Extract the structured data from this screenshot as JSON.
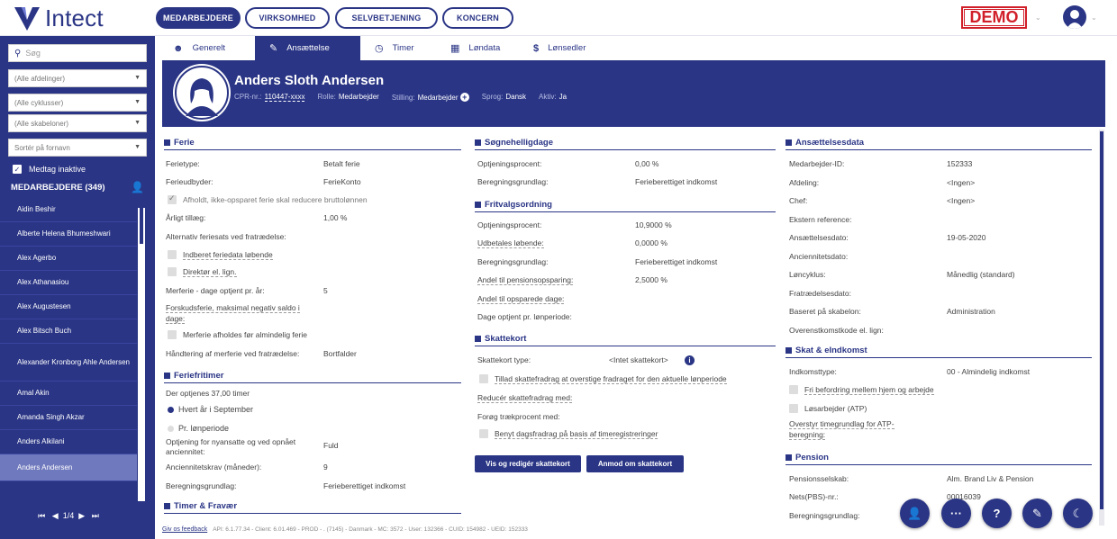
{
  "app": {
    "logo_text": "Intect",
    "demo_label": "DEMO"
  },
  "nav": [
    "MEDARBEJDERE",
    "VIRKSOMHED",
    "SELVBETJENING",
    "KONCERN"
  ],
  "left": {
    "search_placeholder": "Søg",
    "filters": [
      "(Alle afdelinger)",
      "(Alle cyklusser)",
      "(Alle skabeloner)",
      "Sortér på fornavn"
    ],
    "include_inactive": "Medtag inaktive",
    "count_label": "MEDARBEJDERE (349)",
    "employees": [
      "Aidin Beshir",
      "Alberte Helena Bhumeshwari",
      "Alex Agerbo",
      "Alex Athanasiou",
      "Alex Augustesen",
      "Alex Bitsch Buch",
      "Alexander Kronborg Ahle Andersen",
      "Amal Akin",
      "Amanda Singh Akzar",
      "Anders Alkilani",
      "Anders Andersen"
    ],
    "pager": "1/4"
  },
  "tabs": [
    "Generelt",
    "Ansættelse",
    "Timer",
    "Løndata",
    "Lønsedler"
  ],
  "header": {
    "name": "Anders Sloth Andersen",
    "cpr_label": "CPR-nr.:",
    "cpr": "110447-xxxx",
    "role_label": "Rolle:",
    "role": "Medarbejder",
    "position_label": "Stilling:",
    "position": "Medarbejder",
    "lang_label": "Sprog:",
    "lang": "Dansk",
    "active_label": "Aktiv:",
    "active": "Ja"
  },
  "ferie": {
    "title": "Ferie",
    "type_label": "Ferietype:",
    "type": "Betalt ferie",
    "provider_label": "Ferieudbyder:",
    "provider": "FerieKonto",
    "reduce_label": "Afholdt, ikke-opsparet ferie skal reducere bruttolønnen",
    "annual_label": "Årligt tillæg:",
    "annual": "1,00 %",
    "alt_label": "Alternativ feriesats ved fratrædelse:",
    "report_label": "Indberet feriedata løbende",
    "director_label": "Direktør el. lign.",
    "extra_label": "Merferie - dage optjent pr. år:",
    "extra": "5",
    "advance_label1": "Forskudsferie, maksimal negativ saldo i",
    "advance_label2": "dage:",
    "extra_before_label": "Merferie afholdes før almindelig ferie",
    "handling_label": "Håndtering af merferie ved fratrædelse:",
    "handling": "Bortfalder"
  },
  "feriefritimer": {
    "title": "Feriefritimer",
    "earned_label": "Der optjenes 37,00 timer",
    "opt1": "Hvert år i September",
    "opt2": "Pr. lønperiode",
    "new_label1": "Optjening for nyansatte og ved opnået",
    "new_label2": "anciennitet:",
    "new": "Fuld",
    "seniority_label": "Anciennitetskrav (måneder):",
    "seniority": "9",
    "basis_label": "Beregningsgrundlag:",
    "basis": "Ferieberettiget indkomst"
  },
  "timer_fravaer": {
    "title": "Timer & Fravær"
  },
  "soegn": {
    "title": "Søgnehelligdage",
    "pct_label": "Optjeningsprocent:",
    "pct": "0,00 %",
    "basis_label": "Beregningsgrundlag:",
    "basis": "Ferieberettiget indkomst"
  },
  "fritvalg": {
    "title": "Fritvalgsordning",
    "pct_label": "Optjeningsprocent:",
    "pct": "10,9000 %",
    "paid_label": "Udbetales løbende:",
    "paid": "0,0000 %",
    "basis_label": "Beregningsgrundlag:",
    "basis": "Ferieberettiget indkomst",
    "pension_label": "Andel til pensionsopsparing:",
    "pension": "2,5000 %",
    "saved_label": "Andel til opsparede dage:",
    "days_label": "Dage optjent pr. lønperiode:"
  },
  "skattekort": {
    "title": "Skattekort",
    "type_label": "Skattekort type:",
    "type": "<Intet skattekort>",
    "allow_label": "Tillad skattefradrag at overstige fradraget for den aktuelle lønperiode",
    "reduce_label": "Reducér skattefradrag med:",
    "increase_label": "Forøg trækprocent med:",
    "daily_label": "Benyt dagsfradrag på basis af timeregistreringer",
    "btn_edit": "Vis og redigér skattekort",
    "btn_request": "Anmod om skattekort"
  },
  "ansaettelse": {
    "title": "Ansættelsesdata",
    "rows": [
      [
        "Medarbejder-ID:",
        "152333"
      ],
      [
        "Afdeling:",
        "<Ingen>"
      ],
      [
        "Chef:",
        "<Ingen>"
      ],
      [
        "Ekstern reference:",
        ""
      ],
      [
        "Ansættelsesdato:",
        "19-05-2020"
      ],
      [
        "Anciennitetsdato:",
        ""
      ],
      [
        "Løncyklus:",
        "Månedlig (standard)"
      ],
      [
        "Fratrædelsesdato:",
        ""
      ],
      [
        "Baseret på skabelon:",
        "Administration"
      ],
      [
        "Overenstkomstkode el. lign:",
        ""
      ]
    ]
  },
  "skat": {
    "title": "Skat & eIndkomst",
    "type_label": "Indkomsttype:",
    "type": "00 - Almindelig indkomst",
    "free_label": "Fri befordring mellem hjem og arbejde",
    "atp_label": "Løsarbejder (ATP)",
    "override_label1": "Overstyr timegrundlag for ATP-",
    "override_label2": "beregning:"
  },
  "pension": {
    "title": "Pension",
    "company_label": "Pensionsselskab:",
    "company": "Alm. Brand Liv & Pension",
    "nets_label": "Nets(PBS)-nr.:",
    "nets": "00016039",
    "basis_label": "Beregningsgrundlag:"
  },
  "footer": {
    "feedback": "Giv os feedback",
    "info": "API: 6.1.77.34 - Client: 6.01.469 - PROD - . (7145) - Danmark - MC: 3572 - User: 132366 - CUID: 154982 - UEID: 152333"
  },
  "colors": {
    "brand": "#2a3585",
    "demo": "#d11f2a"
  },
  "icons": {
    "fab": [
      "add-user-icon",
      "more-icon",
      "help-icon",
      "edit-icon",
      "moon-icon"
    ]
  }
}
